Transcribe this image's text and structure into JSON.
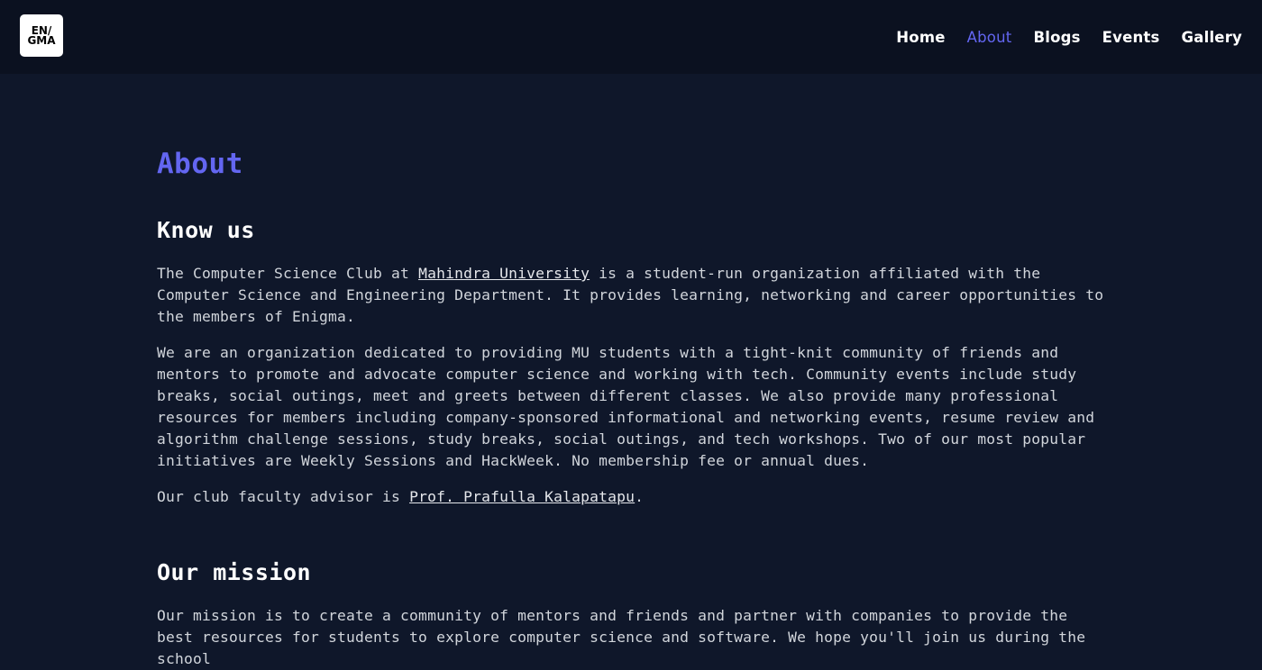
{
  "logo": {
    "line1": "EN/",
    "line2": "GMA"
  },
  "nav": {
    "home": "Home",
    "about": "About",
    "blogs": "Blogs",
    "events": "Events",
    "gallery": "Gallery"
  },
  "page": {
    "title": "About",
    "know_us": {
      "heading": "Know us",
      "p1_before": "The Computer Science Club at ",
      "p1_link": "Mahindra University",
      "p1_after": " is a student-run organization affiliated with the Computer Science and Engineering Department. It provides learning, networking and career opportunities to the members of Enigma.",
      "p2": "We are an organization dedicated to providing MU students with a tight-knit community of friends and mentors to promote and advocate computer science and working with tech. Community events include study breaks, social outings, meet and greets between different classes. We also provide many professional resources for members including company-sponsored informational and networking events, resume review and algorithm challenge sessions, study breaks, social outings, and tech workshops. Two of our most popular initiatives are Weekly Sessions and HackWeek. No membership fee or annual dues.",
      "p3_before": "Our club faculty advisor is ",
      "p3_link": "Prof. Prafulla Kalapatapu",
      "p3_after": "."
    },
    "mission": {
      "heading": "Our mission",
      "p1": "Our mission is to create a community of mentors and friends and partner with companies to provide the best resources for students to explore computer science and software. We hope you'll join us during the school"
    }
  }
}
